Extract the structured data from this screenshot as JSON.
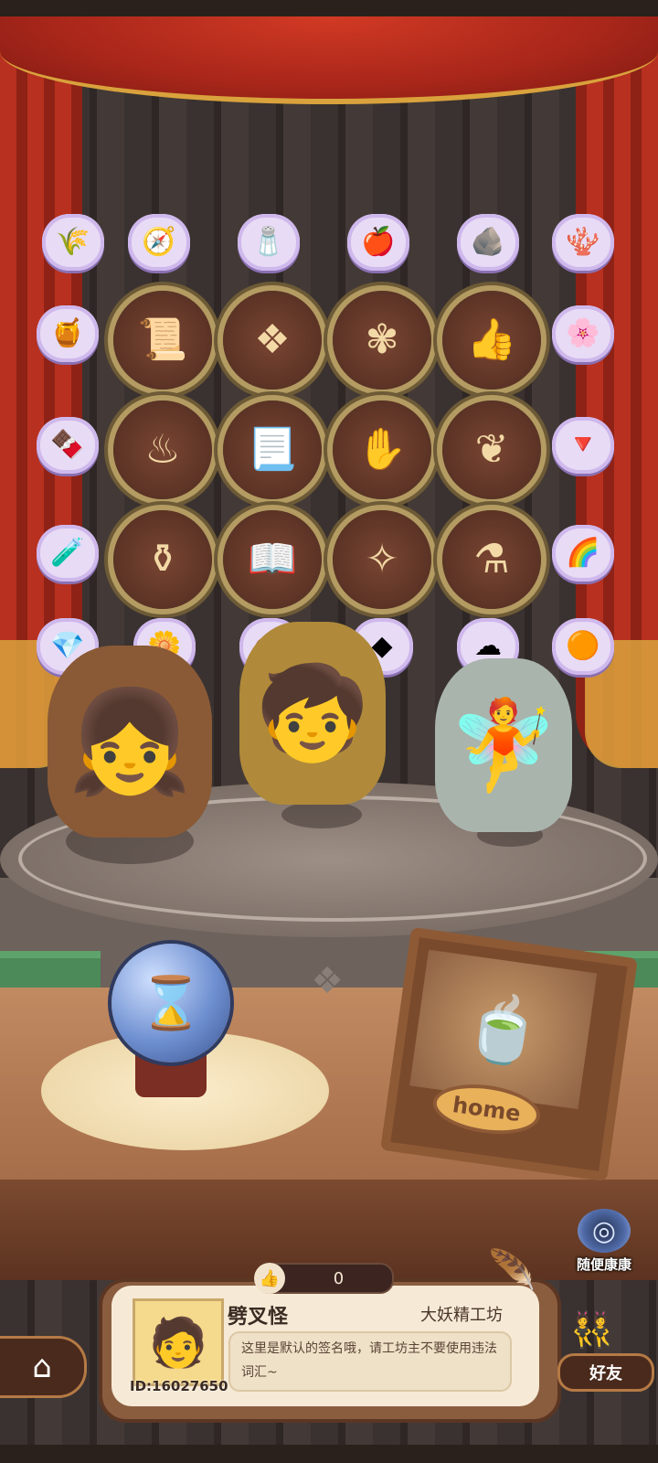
{
  "items": [
    {
      "name": "golden-wheat",
      "icon": "🌾"
    },
    {
      "name": "compass",
      "icon": "🧭"
    },
    {
      "name": "salt-crystals",
      "icon": "🧂"
    },
    {
      "name": "red-apple",
      "icon": "🍎"
    },
    {
      "name": "ore-chunk",
      "icon": "🪨"
    },
    {
      "name": "red-coral",
      "icon": "🪸"
    },
    {
      "name": "honeycomb",
      "icon": "🍯"
    },
    {
      "name": "purple-flower",
      "icon": "🌸"
    },
    {
      "name": "chocolate-block",
      "icon": "🍫"
    },
    {
      "name": "dark-shard",
      "icon": "🔻"
    },
    {
      "name": "green-potion",
      "icon": "🧪"
    },
    {
      "name": "rainbow-feather",
      "icon": "🌈"
    },
    {
      "name": "blue-crystal",
      "icon": "💎"
    },
    {
      "name": "blue-flower",
      "icon": "🌼"
    },
    {
      "name": "white-seed",
      "icon": "🌰"
    },
    {
      "name": "black-stone",
      "icon": "◆"
    },
    {
      "name": "cotton",
      "icon": "☁"
    },
    {
      "name": "copper-ore",
      "icon": "🟠"
    }
  ],
  "badges": [
    {
      "name": "contract-badge",
      "icon": "📜"
    },
    {
      "name": "rune-badge",
      "icon": "❖"
    },
    {
      "name": "crest-badge",
      "icon": "✾"
    },
    {
      "name": "thumbs-up-badge",
      "icon": "👍"
    },
    {
      "name": "cauldron-badge",
      "icon": "♨"
    },
    {
      "name": "scroll-badge",
      "icon": "📃"
    },
    {
      "name": "hand-badge",
      "icon": "✋"
    },
    {
      "name": "ornament-badge",
      "icon": "❦"
    },
    {
      "name": "pot-badge",
      "icon": "⚱"
    },
    {
      "name": "book-badge",
      "icon": "📖"
    },
    {
      "name": "fairy-badge",
      "icon": "✧"
    },
    {
      "name": "cauldron-sparkle-badge",
      "icon": "⚗"
    }
  ],
  "characters": [
    {
      "name": "red-hood-girl",
      "icon": "👧"
    },
    {
      "name": "telescope-boy",
      "icon": "🧒"
    },
    {
      "name": "test-tube-fairy",
      "icon": "🧚"
    }
  ],
  "hourglass_icon": "⌛",
  "home_frame": {
    "label": "home",
    "icon": "🍵"
  },
  "random_visit": {
    "label": "随便康康",
    "icon": "◎"
  },
  "likes": {
    "icon": "👍",
    "count": "0"
  },
  "profile": {
    "avatar_icon": "🧑",
    "id_text": "ID:16027650",
    "username": "劈叉怪",
    "shop_name": "大妖精工坊",
    "signature": "这里是默认的签名哦，请工坊主不要使用违法词汇~"
  },
  "edit_icon": "🪶",
  "home_button_icon": "⌂",
  "friends": {
    "label": "好友",
    "icon": "👯"
  }
}
